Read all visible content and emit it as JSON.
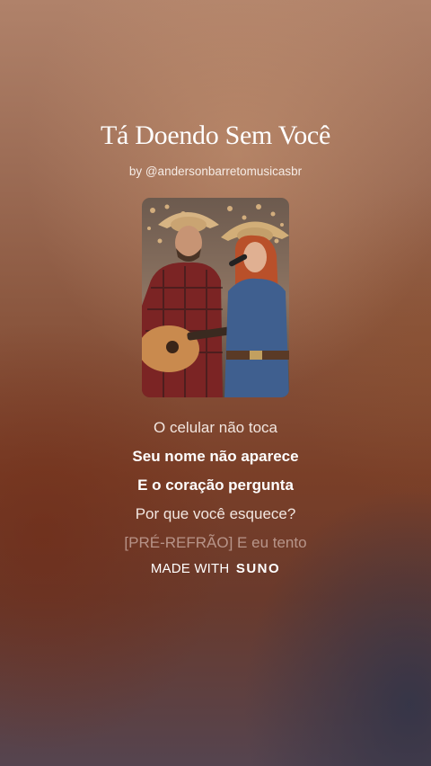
{
  "song": {
    "title": "Tá Doendo Sem Você",
    "byline": "by @andersonbarretomusicasbr"
  },
  "cover": {
    "icon": "album-cover-art"
  },
  "lyrics": [
    {
      "text": "O celular não toca",
      "state": "normal"
    },
    {
      "text": "Seu nome não aparece",
      "state": "active"
    },
    {
      "text": "E o coração pergunta",
      "state": "active"
    },
    {
      "text": "Por que você esquece?",
      "state": "normal"
    },
    {
      "text": "[PRÉ-REFRÃO] E eu tento",
      "state": "faded"
    }
  ],
  "footer": {
    "made_with": "MADE WITH",
    "brand": "SUNO"
  },
  "colors": {
    "text": "#ffffff",
    "background_top": "#b0826a",
    "background_bottom": "#55444f"
  }
}
